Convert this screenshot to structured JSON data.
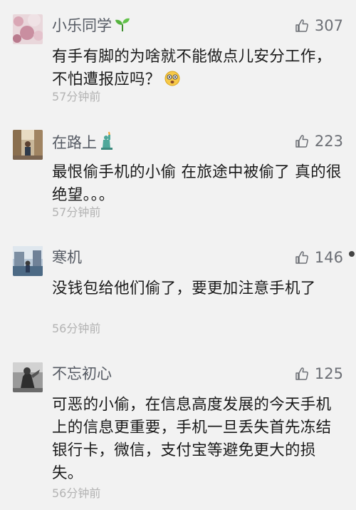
{
  "comments": [
    {
      "username": "小乐同学",
      "likes": "307",
      "content": "有手有脚的为啥就不能做点儿安分工作，不怕遭报应吗？",
      "time": "57分钟前",
      "avatar_icon": "avatar-pink-flowers",
      "name_emoji": "seedling-icon",
      "content_emoji": "dizzy-face-icon"
    },
    {
      "username": "在路上",
      "likes": "223",
      "content": "最恨偷手机的小偷 在旅途中被偷了 真的很绝望。。。",
      "time": "57分钟前",
      "avatar_icon": "avatar-street-photo",
      "name_emoji": "statue-of-liberty-icon"
    },
    {
      "username": "寒机",
      "likes": "146",
      "content": "没钱包给他们偷了，要更加注意手机了",
      "time": "56分钟前",
      "avatar_icon": "avatar-riverside-photo"
    },
    {
      "username": "不忘初心",
      "likes": "125",
      "content": "可恶的小偷，在信息高度发展的今天手机上的信息更重要，手机一旦丢失首先冻结银行卡，微信，支付宝等避免更大的损失。",
      "time": "56分钟前",
      "avatar_icon": "avatar-dark-figure"
    }
  ],
  "colors": {
    "background": "#f2f2f2",
    "username": "#555a63",
    "content": "#1a1a1a",
    "time": "#b3b3b3",
    "like": "#6c6f75"
  }
}
